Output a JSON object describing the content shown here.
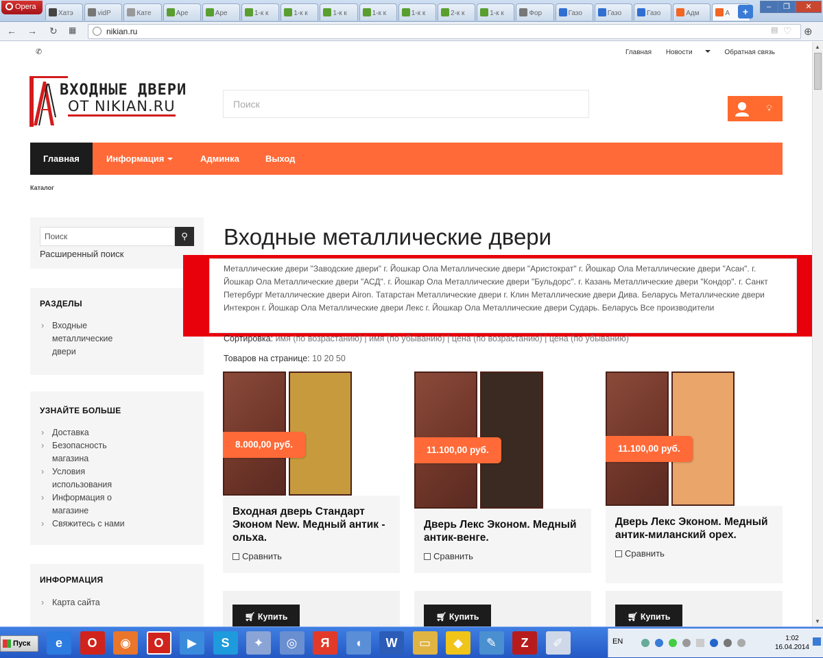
{
  "browser": {
    "menu_label": "Opera",
    "url": "nikian.ru",
    "tabs": [
      {
        "label": "Хатэ",
        "color": "#444"
      },
      {
        "label": "vidP",
        "color": "#777"
      },
      {
        "label": "Кате",
        "color": "#999"
      },
      {
        "label": "Аре",
        "color": "#5a9e2f"
      },
      {
        "label": "Аре",
        "color": "#5a9e2f"
      },
      {
        "label": "1-к к",
        "color": "#5a9e2f"
      },
      {
        "label": "1-к к",
        "color": "#5a9e2f"
      },
      {
        "label": "1-к к",
        "color": "#5a9e2f"
      },
      {
        "label": "1-к к",
        "color": "#5a9e2f"
      },
      {
        "label": "1-к к",
        "color": "#5a9e2f"
      },
      {
        "label": "2-к к",
        "color": "#5a9e2f"
      },
      {
        "label": "1-к к",
        "color": "#5a9e2f"
      },
      {
        "label": "Фор",
        "color": "#777"
      },
      {
        "label": "Газо",
        "color": "#2f6fd1"
      },
      {
        "label": "Газо",
        "color": "#2f6fd1"
      },
      {
        "label": "Газо",
        "color": "#2f6fd1"
      },
      {
        "label": "Адм",
        "color": "#f26522"
      },
      {
        "label": "А",
        "color": "#f26522"
      }
    ]
  },
  "site": {
    "top_links": [
      "Главная",
      "Новости",
      "Обратная связь"
    ],
    "logo_line1": "ВХОДНЫЕ ДВЕРИ",
    "logo_line2": "ОТ NIKIAN.RU",
    "search_placeholder": "Поиск",
    "nav": [
      "Главная",
      "Информация",
      "Админка",
      "Выход"
    ],
    "breadcrumb": "Каталог",
    "accent": "#ff6a38"
  },
  "sidebar": {
    "search_placeholder": "Поиск",
    "advanced_search": "Расширенный поиск",
    "sections_title": "РАЗДЕЛЫ",
    "sections": [
      "Входные металлические двери"
    ],
    "more_title": "УЗНАЙТЕ БОЛЬШЕ",
    "more": [
      "Доставка",
      "Безопасность магазина",
      "Условия использования",
      "Информация о магазине",
      "Свяжитесь с нами"
    ],
    "info_title": "ИНФОРМАЦИЯ",
    "info": [
      "Карта сайта"
    ]
  },
  "main": {
    "title": "Входные металлические двери",
    "manufacturers_text": "Металлические двери \"Заводские двери\" г. Йошкар Ола Металлические двери \"Аристократ\" г. Йошкар Ола Металлические двери \"Асан\". г. Йошкар Ола Металлические двери \"АСД\". г. Йошкар Ола Металлические двери \"Бульдорс\". г. Казань Металлические двери \"Кондор\". г. Санкт Петербург Металлические двери Airon. Татарстан Металлические двери г. Клин Металлические двери Дива. Беларусь Металлические двери Интекрон г. Йошкар Ола Металлические двери Лекс г. Йошкар Ола Металлические двери Сударь. Беларусь Все производители",
    "sort_label": "Сортировка:",
    "sort_options": "имя (по возрастанию) | имя (по убыванию) | цена (по возрастанию) | цена (по убыванию)",
    "per_page_label": "Товаров на странице:",
    "per_page_options": "10 20 50",
    "compare_label": "Сравнить",
    "buy_label": "Купить",
    "products": [
      {
        "name": "Входная дверь Стандарт Эконом New. Медный антик - ольха.",
        "price": "8.000,00 руб.",
        "inner_color": "#c89a3e"
      },
      {
        "name": "Дверь Лекс Эконом. Медный антик-венге.",
        "price": "11.100,00 руб.",
        "inner_color": "#3a2a22"
      },
      {
        "name": "Дверь Лекс Эконом. Медный антик-миланский орех.",
        "price": "11.100,00 руб.",
        "inner_color": "#e9a56a"
      }
    ]
  },
  "taskbar": {
    "start_label": "Пуск",
    "lang": "EN",
    "time": "1:02",
    "date": "16.04.2014"
  }
}
